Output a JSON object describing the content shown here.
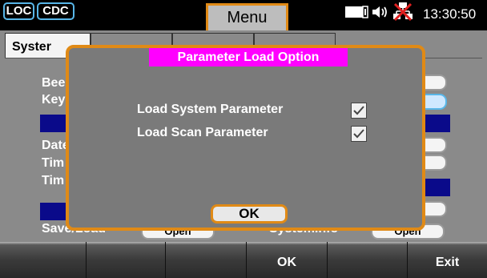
{
  "topbar": {
    "loc_label": "LOC",
    "cdc_label": "CDC",
    "menu_title": "Menu",
    "clock": "13:30:50"
  },
  "panel": {
    "tabs": [
      {
        "label": "Syster",
        "active": true
      },
      {
        "label": "",
        "active": false
      },
      {
        "label": "",
        "active": false
      },
      {
        "label": "",
        "active": false
      }
    ],
    "rows": [
      {
        "label": "Bee"
      },
      {
        "label": "Key"
      },
      {
        "label": ""
      },
      {
        "label": "Date"
      },
      {
        "label": "Tim"
      },
      {
        "label": "Tim"
      },
      {
        "label": ""
      },
      {
        "label": "Save/Load"
      }
    ],
    "bottom_row": {
      "left_pill": "Open",
      "right_label": "SystemInfo",
      "right_pill": "Open"
    }
  },
  "dialog": {
    "title": "Parameter Load Option",
    "options": [
      {
        "label": "Load System Parameter",
        "checked": true
      },
      {
        "label": "Load Scan Parameter",
        "checked": true
      }
    ],
    "ok_label": "OK"
  },
  "softkeys": [
    "",
    "",
    "",
    "OK",
    "",
    "Exit"
  ],
  "colors": {
    "accent_orange": "#e08a16",
    "title_magenta": "#ff00ff",
    "selection_blue": "#0a0a8a",
    "mode_border": "#58b6e8"
  },
  "icons": [
    "battery-icon",
    "speaker-icon",
    "network-disconnected-icon"
  ]
}
